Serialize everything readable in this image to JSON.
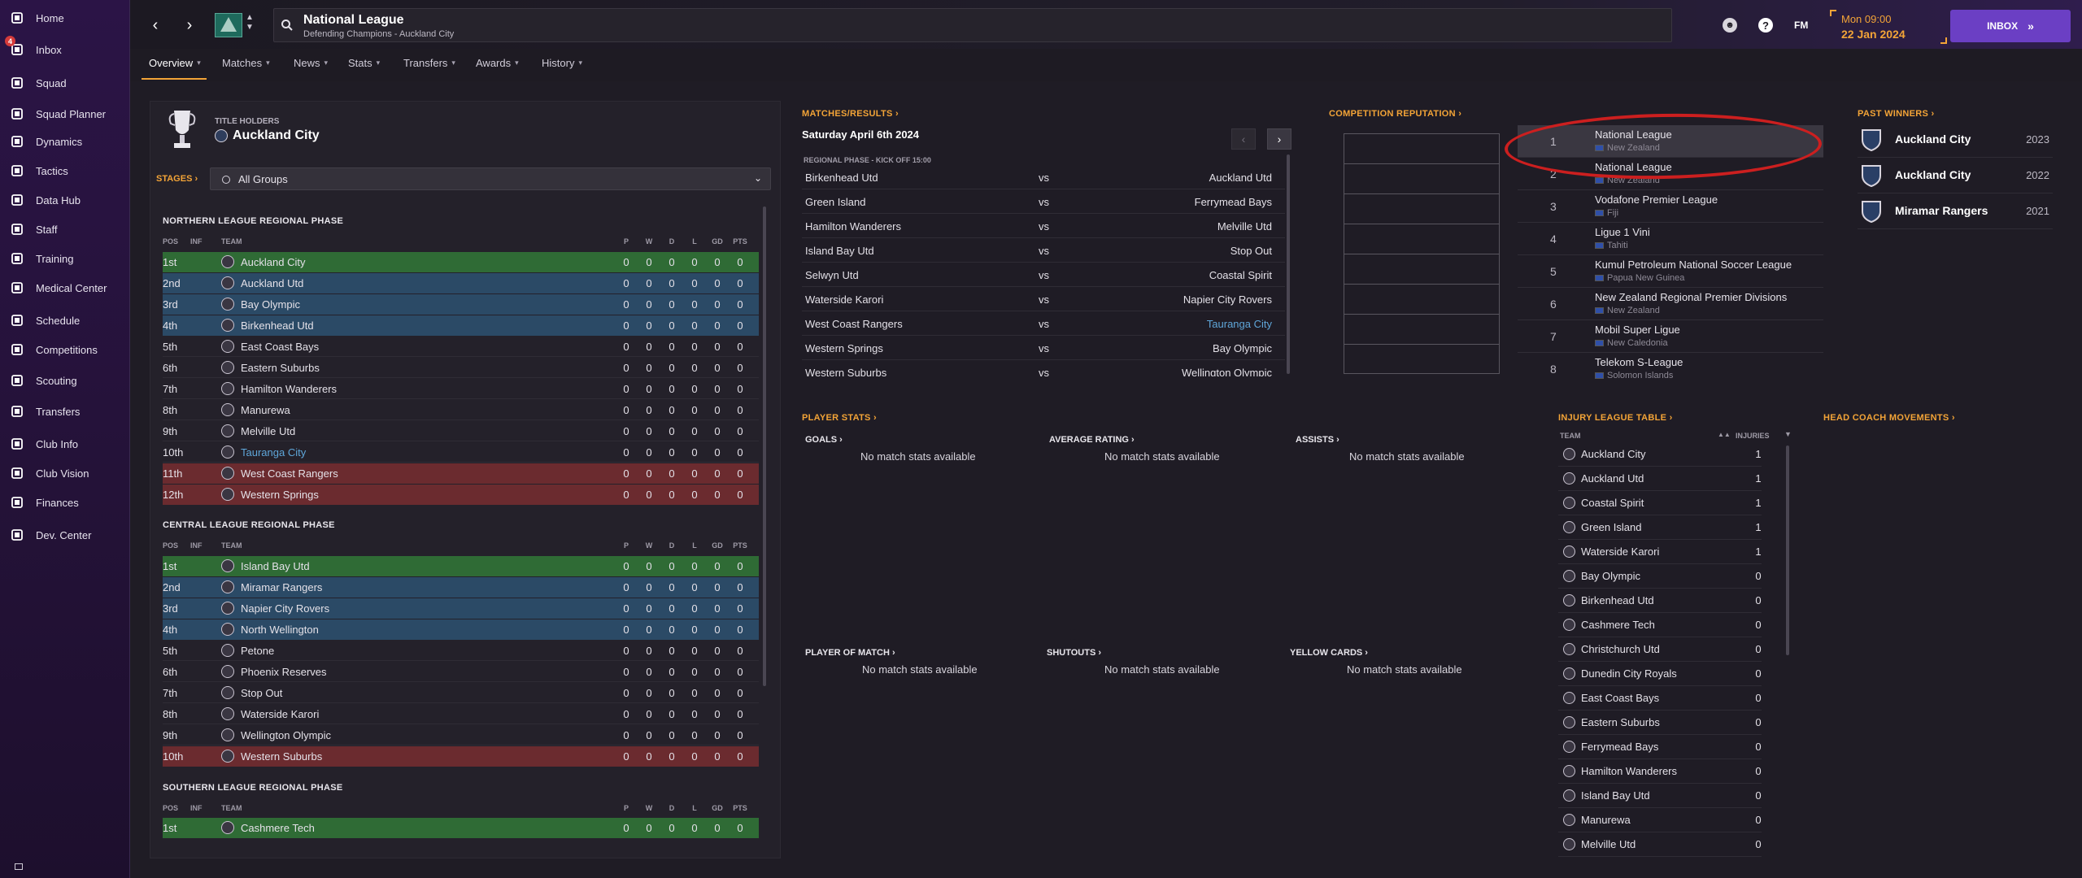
{
  "sidebar": {
    "items": [
      {
        "label": "Home",
        "icon": "home-icon"
      },
      {
        "label": "Inbox",
        "icon": "inbox-icon",
        "badge": "4"
      },
      {
        "label": "Squad",
        "icon": "shirt-icon"
      },
      {
        "label": "Squad Planner",
        "icon": "planner-icon"
      },
      {
        "label": "Dynamics",
        "icon": "dynamics-icon"
      },
      {
        "label": "Tactics",
        "icon": "tactics-icon"
      },
      {
        "label": "Data Hub",
        "icon": "data-hub-icon"
      },
      {
        "label": "Staff",
        "icon": "staff-icon"
      },
      {
        "label": "Training",
        "icon": "training-icon"
      },
      {
        "label": "Medical Center",
        "icon": "medical-icon"
      },
      {
        "label": "Schedule",
        "icon": "calendar-icon"
      },
      {
        "label": "Competitions",
        "icon": "trophy-icon"
      },
      {
        "label": "Scouting",
        "icon": "scouting-icon"
      },
      {
        "label": "Transfers",
        "icon": "transfers-icon"
      },
      {
        "label": "Club Info",
        "icon": "shield-icon"
      },
      {
        "label": "Club Vision",
        "icon": "vision-icon"
      },
      {
        "label": "Finances",
        "icon": "finances-icon"
      },
      {
        "label": "Dev. Center",
        "icon": "dev-center-icon"
      }
    ]
  },
  "header": {
    "title": "National League",
    "subtitle": "Defending Champions - Auckland City",
    "time": "Mon 09:00",
    "date": "22 Jan 2024",
    "inbox_label": "INBOX",
    "fm_label": "FM",
    "help_label": "?"
  },
  "tabs": [
    "Overview",
    "Matches",
    "News",
    "Stats",
    "Transfers",
    "Awards",
    "History"
  ],
  "title_holders": {
    "label": "TITLE HOLDERS",
    "team": "Auckland City"
  },
  "stages": {
    "label": "STAGES",
    "select": "All Groups"
  },
  "columns": {
    "pos": "POS",
    "inf": "INF",
    "team": "TEAM",
    "p": "P",
    "w": "W",
    "d": "D",
    "l": "L",
    "gd": "GD",
    "pts": "PTS"
  },
  "groups": [
    {
      "name": "NORTHERN LEAGUE REGIONAL PHASE",
      "rows": [
        {
          "pos": "1st",
          "team": "Auckland City",
          "p": "0",
          "w": "0",
          "d": "0",
          "l": "0",
          "gd": "0",
          "pts": "0"
        },
        {
          "pos": "2nd",
          "team": "Auckland Utd",
          "p": "0",
          "w": "0",
          "d": "0",
          "l": "0",
          "gd": "0",
          "pts": "0"
        },
        {
          "pos": "3rd",
          "team": "Bay Olympic",
          "p": "0",
          "w": "0",
          "d": "0",
          "l": "0",
          "gd": "0",
          "pts": "0"
        },
        {
          "pos": "4th",
          "team": "Birkenhead Utd",
          "p": "0",
          "w": "0",
          "d": "0",
          "l": "0",
          "gd": "0",
          "pts": "0"
        },
        {
          "pos": "5th",
          "team": "East Coast Bays",
          "p": "0",
          "w": "0",
          "d": "0",
          "l": "0",
          "gd": "0",
          "pts": "0"
        },
        {
          "pos": "6th",
          "team": "Eastern Suburbs",
          "p": "0",
          "w": "0",
          "d": "0",
          "l": "0",
          "gd": "0",
          "pts": "0"
        },
        {
          "pos": "7th",
          "team": "Hamilton Wanderers",
          "p": "0",
          "w": "0",
          "d": "0",
          "l": "0",
          "gd": "0",
          "pts": "0"
        },
        {
          "pos": "8th",
          "team": "Manurewa",
          "p": "0",
          "w": "0",
          "d": "0",
          "l": "0",
          "gd": "0",
          "pts": "0"
        },
        {
          "pos": "9th",
          "team": "Melville Utd",
          "p": "0",
          "w": "0",
          "d": "0",
          "l": "0",
          "gd": "0",
          "pts": "0"
        },
        {
          "pos": "10th",
          "team": "Tauranga City",
          "p": "0",
          "w": "0",
          "d": "0",
          "l": "0",
          "gd": "0",
          "pts": "0"
        },
        {
          "pos": "11th",
          "team": "West Coast Rangers",
          "p": "0",
          "w": "0",
          "d": "0",
          "l": "0",
          "gd": "0",
          "pts": "0"
        },
        {
          "pos": "12th",
          "team": "Western Springs",
          "p": "0",
          "w": "0",
          "d": "0",
          "l": "0",
          "gd": "0",
          "pts": "0"
        }
      ]
    },
    {
      "name": "CENTRAL LEAGUE REGIONAL PHASE",
      "rows": [
        {
          "pos": "1st",
          "team": "Island Bay Utd",
          "p": "0",
          "w": "0",
          "d": "0",
          "l": "0",
          "gd": "0",
          "pts": "0"
        },
        {
          "pos": "2nd",
          "team": "Miramar Rangers",
          "p": "0",
          "w": "0",
          "d": "0",
          "l": "0",
          "gd": "0",
          "pts": "0"
        },
        {
          "pos": "3rd",
          "team": "Napier City Rovers",
          "p": "0",
          "w": "0",
          "d": "0",
          "l": "0",
          "gd": "0",
          "pts": "0"
        },
        {
          "pos": "4th",
          "team": "North Wellington",
          "p": "0",
          "w": "0",
          "d": "0",
          "l": "0",
          "gd": "0",
          "pts": "0"
        },
        {
          "pos": "5th",
          "team": "Petone",
          "p": "0",
          "w": "0",
          "d": "0",
          "l": "0",
          "gd": "0",
          "pts": "0"
        },
        {
          "pos": "6th",
          "team": "Phoenix Reserves",
          "p": "0",
          "w": "0",
          "d": "0",
          "l": "0",
          "gd": "0",
          "pts": "0"
        },
        {
          "pos": "7th",
          "team": "Stop Out",
          "p": "0",
          "w": "0",
          "d": "0",
          "l": "0",
          "gd": "0",
          "pts": "0"
        },
        {
          "pos": "8th",
          "team": "Waterside Karori",
          "p": "0",
          "w": "0",
          "d": "0",
          "l": "0",
          "gd": "0",
          "pts": "0"
        },
        {
          "pos": "9th",
          "team": "Wellington Olympic",
          "p": "0",
          "w": "0",
          "d": "0",
          "l": "0",
          "gd": "0",
          "pts": "0"
        },
        {
          "pos": "10th",
          "team": "Western Suburbs",
          "p": "0",
          "w": "0",
          "d": "0",
          "l": "0",
          "gd": "0",
          "pts": "0"
        }
      ]
    },
    {
      "name": "SOUTHERN LEAGUE REGIONAL PHASE",
      "rows": [
        {
          "pos": "1st",
          "team": "Cashmere Tech",
          "p": "0",
          "w": "0",
          "d": "0",
          "l": "0",
          "gd": "0",
          "pts": "0"
        }
      ]
    }
  ],
  "matches": {
    "title": "MATCHES/RESULTS",
    "date": "Saturday April 6th 2024",
    "phase": "REGIONAL PHASE - KICK OFF 15:00",
    "vs": "vs",
    "rows": [
      {
        "home": "Birkenhead Utd",
        "away": "Auckland Utd"
      },
      {
        "home": "Green Island",
        "away": "Ferrymead Bays"
      },
      {
        "home": "Hamilton Wanderers",
        "away": "Melville Utd"
      },
      {
        "home": "Island Bay Utd",
        "away": "Stop Out"
      },
      {
        "home": "Selwyn Utd",
        "away": "Coastal Spirit"
      },
      {
        "home": "Waterside Karori",
        "away": "Napier City Rovers"
      },
      {
        "home": "West Coast Rangers",
        "away": "Tauranga City"
      },
      {
        "home": "Western Springs",
        "away": "Bay Olympic"
      },
      {
        "home": "Western Suburbs",
        "away": "Wellington Olympic"
      }
    ]
  },
  "reputation": {
    "title": "COMPETITION REPUTATION",
    "rows": [
      {
        "rank": "1",
        "name": "National League",
        "country": "New Zealand"
      },
      {
        "rank": "2",
        "name": "National League",
        "country": "New Zealand"
      },
      {
        "rank": "3",
        "name": "Vodafone Premier League",
        "country": "Fiji"
      },
      {
        "rank": "4",
        "name": "Ligue 1 Vini",
        "country": "Tahiti"
      },
      {
        "rank": "5",
        "name": "Kumul Petroleum National Soccer League",
        "country": "Papua New Guinea"
      },
      {
        "rank": "6",
        "name": "New Zealand Regional Premier Divisions",
        "country": "New Zealand"
      },
      {
        "rank": "7",
        "name": "Mobil Super Ligue",
        "country": "New Caledonia"
      },
      {
        "rank": "8",
        "name": "Telekom S-League",
        "country": "Solomon Islands"
      }
    ]
  },
  "past_winners": {
    "title": "PAST WINNERS",
    "rows": [
      {
        "team": "Auckland City",
        "year": "2023"
      },
      {
        "team": "Auckland City",
        "year": "2022"
      },
      {
        "team": "Miramar Rangers",
        "year": "2021"
      }
    ]
  },
  "player_stats": {
    "title": "PLAYER STATS",
    "items": [
      {
        "label": "GOALS",
        "value": "No match stats available"
      },
      {
        "label": "AVERAGE RATING",
        "value": "No match stats available"
      },
      {
        "label": "ASSISTS",
        "value": "No match stats available"
      },
      {
        "label": "PLAYER OF MATCH",
        "value": "No match stats available"
      },
      {
        "label": "SHUTOUTS",
        "value": "No match stats available"
      },
      {
        "label": "YELLOW CARDS",
        "value": "No match stats available"
      }
    ]
  },
  "injury": {
    "title": "INJURY LEAGUE TABLE",
    "col_team": "TEAM",
    "col_inj": "INJURIES",
    "rows": [
      {
        "team": "Auckland City",
        "v": "1"
      },
      {
        "team": "Auckland Utd",
        "v": "1"
      },
      {
        "team": "Coastal Spirit",
        "v": "1"
      },
      {
        "team": "Green Island",
        "v": "1"
      },
      {
        "team": "Waterside Karori",
        "v": "1"
      },
      {
        "team": "Bay Olympic",
        "v": "0"
      },
      {
        "team": "Birkenhead Utd",
        "v": "0"
      },
      {
        "team": "Cashmere Tech",
        "v": "0"
      },
      {
        "team": "Christchurch Utd",
        "v": "0"
      },
      {
        "team": "Dunedin City Royals",
        "v": "0"
      },
      {
        "team": "East Coast Bays",
        "v": "0"
      },
      {
        "team": "Eastern Suburbs",
        "v": "0"
      },
      {
        "team": "Ferrymead Bays",
        "v": "0"
      },
      {
        "team": "Hamilton Wanderers",
        "v": "0"
      },
      {
        "team": "Island Bay Utd",
        "v": "0"
      },
      {
        "team": "Manurewa",
        "v": "0"
      },
      {
        "team": "Melville Utd",
        "v": "0"
      }
    ]
  },
  "head_coach": {
    "title": "HEAD COACH MOVEMENTS"
  },
  "colors": {
    "accent": "#f3a437",
    "promo": "#2f6b35",
    "playoff": "#2b4a66",
    "releg": "#6b2b2f",
    "link": "#5fa6d9",
    "annotation": "#cc1f1f"
  }
}
